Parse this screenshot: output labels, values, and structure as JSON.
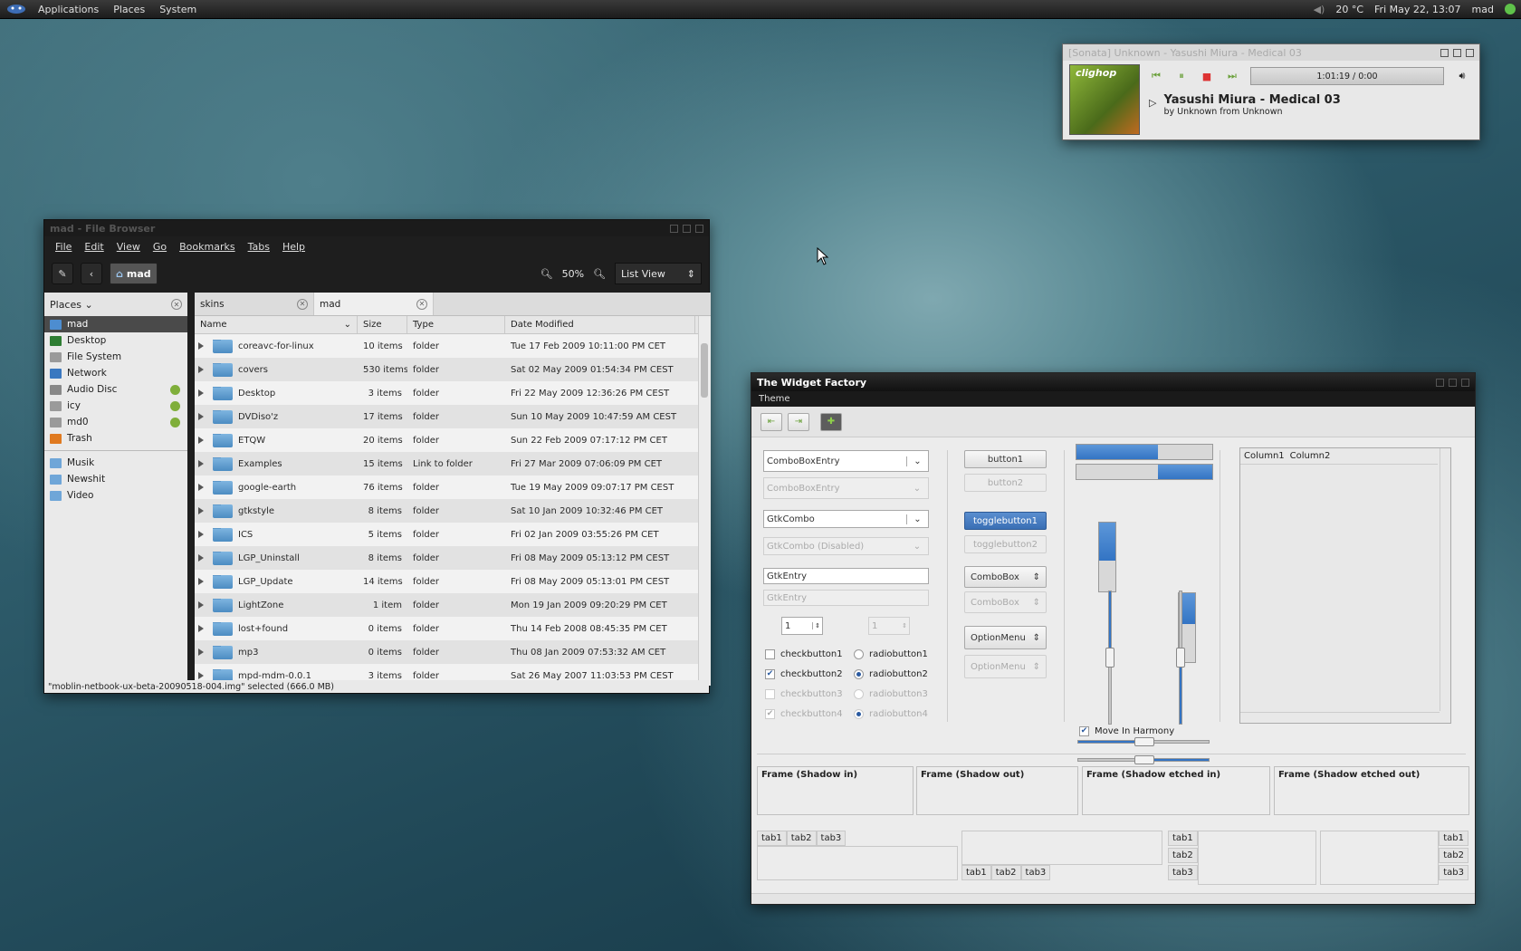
{
  "panel": {
    "menus": [
      "Applications",
      "Places",
      "System"
    ],
    "temperature": "20 °C",
    "datetime": "Fri May 22, 13:07",
    "user": "mad"
  },
  "file_browser": {
    "title": "mad - File Browser",
    "menus": [
      "File",
      "Edit",
      "View",
      "Go",
      "Bookmarks",
      "Tabs",
      "Help"
    ],
    "crumb": "mad",
    "zoom": "50%",
    "view_mode": "List View",
    "places_header": "Places",
    "places": [
      {
        "label": "mad",
        "icon": "home-icon",
        "selected": true
      },
      {
        "label": "Desktop",
        "icon": "desktop-icon"
      },
      {
        "label": "File System",
        "icon": "drive-icon"
      },
      {
        "label": "Network",
        "icon": "network-icon"
      },
      {
        "label": "Audio Disc",
        "icon": "disc-icon",
        "eject": true
      },
      {
        "label": "icy",
        "icon": "drive-icon",
        "eject": true
      },
      {
        "label": "md0",
        "icon": "drive-icon",
        "eject": true
      },
      {
        "label": "Trash",
        "icon": "trash-icon"
      }
    ],
    "bookmarks": [
      "Musik",
      "Newshit",
      "Video"
    ],
    "tabs": [
      "skins",
      "mad"
    ],
    "columns": [
      "Name",
      "Size",
      "Type",
      "Date Modified"
    ],
    "rows": [
      [
        "coreavc-for-linux",
        "10 items",
        "folder",
        "Tue 17 Feb 2009 10:11:00 PM CET"
      ],
      [
        "covers",
        "530 items",
        "folder",
        "Sat 02 May 2009 01:54:34 PM CEST"
      ],
      [
        "Desktop",
        "3 items",
        "folder",
        "Fri 22 May 2009 12:36:26 PM CEST"
      ],
      [
        "DVDiso'z",
        "17 items",
        "folder",
        "Sun 10 May 2009 10:47:59 AM CEST"
      ],
      [
        "ETQW",
        "20 items",
        "folder",
        "Sun 22 Feb 2009 07:17:12 PM CET"
      ],
      [
        "Examples",
        "15 items",
        "Link to folder",
        "Fri 27 Mar 2009 07:06:09 PM CET"
      ],
      [
        "google-earth",
        "76 items",
        "folder",
        "Tue 19 May 2009 09:07:17 PM CEST"
      ],
      [
        "gtkstyle",
        "8 items",
        "folder",
        "Sat 10 Jan 2009 10:32:46 PM CET"
      ],
      [
        "ICS",
        "5 items",
        "folder",
        "Fri 02 Jan 2009 03:55:26 PM CET"
      ],
      [
        "LGP_Uninstall",
        "8 items",
        "folder",
        "Fri 08 May 2009 05:13:12 PM CEST"
      ],
      [
        "LGP_Update",
        "14 items",
        "folder",
        "Fri 08 May 2009 05:13:01 PM CEST"
      ],
      [
        "LightZone",
        "1 item",
        "folder",
        "Mon 19 Jan 2009 09:20:29 PM CET"
      ],
      [
        "lost+found",
        "0 items",
        "folder",
        "Thu 14 Feb 2008 08:45:35 PM CET"
      ],
      [
        "mp3",
        "0 items",
        "folder",
        "Thu 08 Jan 2009 07:53:32 AM CET"
      ],
      [
        "mpd-mdm-0.0.1",
        "3 items",
        "folder",
        "Sat 26 May 2007 11:03:53 PM CEST"
      ]
    ],
    "status": "\"moblin-netbook-ux-beta-20090518-004.img\" selected (666.0 MB)"
  },
  "player": {
    "title": "[Sonata] Unknown - Yasushi Miura - Medical 03",
    "album_art_text": "clighop",
    "time": "1:01:19 / 0:00",
    "track": "Yasushi Miura - Medical 03",
    "byline": "by Unknown from Unknown"
  },
  "widget_factory": {
    "title": "The Widget Factory",
    "menu": "Theme",
    "combo_entry": "ComboBoxEntry",
    "combo_entry_dis": "ComboBoxEntry",
    "gtk_combo": "GtkCombo",
    "gtk_combo_dis": "GtkCombo (Disabled)",
    "gtk_entry": "GtkEntry",
    "gtk_entry_dis": "GtkEntry",
    "spin1": "1",
    "spin2": "1",
    "check1": "checkbutton1",
    "check2": "checkbutton2",
    "check3": "checkbutton3",
    "check4": "checkbutton4",
    "radio1": "radiobutton1",
    "radio2": "radiobutton2",
    "radio3": "radiobutton3",
    "radio4": "radiobutton4",
    "button1": "button1",
    "button2": "button2",
    "toggle1": "togglebutton1",
    "toggle2": "togglebutton2",
    "combobox": "ComboBox",
    "combobox_dis": "ComboBox",
    "optionmenu": "OptionMenu",
    "optionmenu_dis": "OptionMenu",
    "harmony": "Move In Harmony",
    "col1": "Column1",
    "col2": "Column2",
    "frames": [
      "Frame (Shadow in)",
      "Frame (Shadow out)",
      "Frame (Shadow etched in)",
      "Frame (Shadow etched out)"
    ],
    "tab_labels": [
      "tab1",
      "tab2",
      "tab3"
    ],
    "progress": [
      0.6,
      0.4
    ],
    "vprogress": [
      0.55,
      0.45
    ]
  }
}
